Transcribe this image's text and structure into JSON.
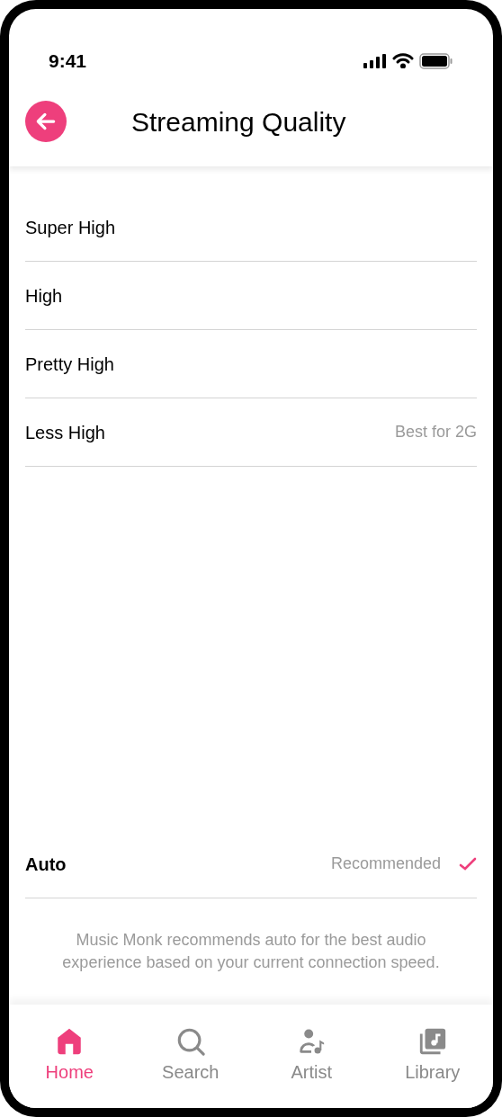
{
  "status_bar": {
    "time": "9:41"
  },
  "header": {
    "title": "Streaming Quality"
  },
  "options": [
    {
      "label": "Super High",
      "selected": false
    },
    {
      "label": "High",
      "selected": false
    },
    {
      "label": "Pretty High",
      "selected": false
    },
    {
      "label": "Less High",
      "note": "Best for 2G",
      "selected": false
    }
  ],
  "auto_option": {
    "label": "Auto",
    "note": "Recommended",
    "selected": true
  },
  "description": "Music Monk recommends auto for the best audio experience based on your current connection speed.",
  "nav": [
    {
      "label": "Home",
      "kind": "home",
      "selected": true
    },
    {
      "label": "Search",
      "kind": "search",
      "selected": false
    },
    {
      "label": "Artist",
      "kind": "artist",
      "selected": false
    },
    {
      "label": "Library",
      "kind": "library",
      "selected": false
    }
  ]
}
